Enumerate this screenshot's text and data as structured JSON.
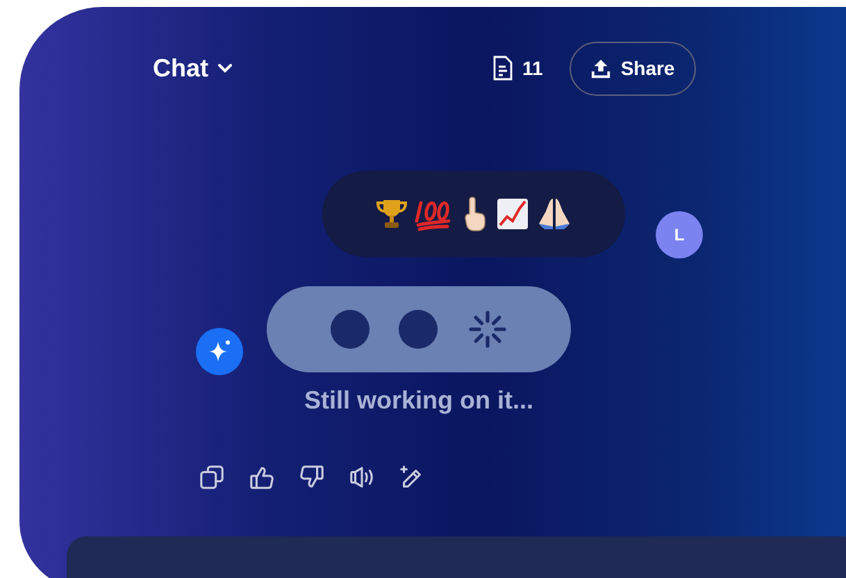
{
  "header": {
    "title": "Chat",
    "document_count": "11",
    "share_button": "Share"
  },
  "messages": [
    {
      "kind": "user",
      "avatar": "L"
    },
    {
      "kind": "assistant",
      "status": "Still working on it..."
    }
  ],
  "actions": [
    {
      "kind": "copy"
    },
    {
      "kind": "like"
    },
    {
      "kind": "dislike"
    },
    {
      "kind": "speak"
    },
    {
      "kind": "edit"
    }
  ]
}
